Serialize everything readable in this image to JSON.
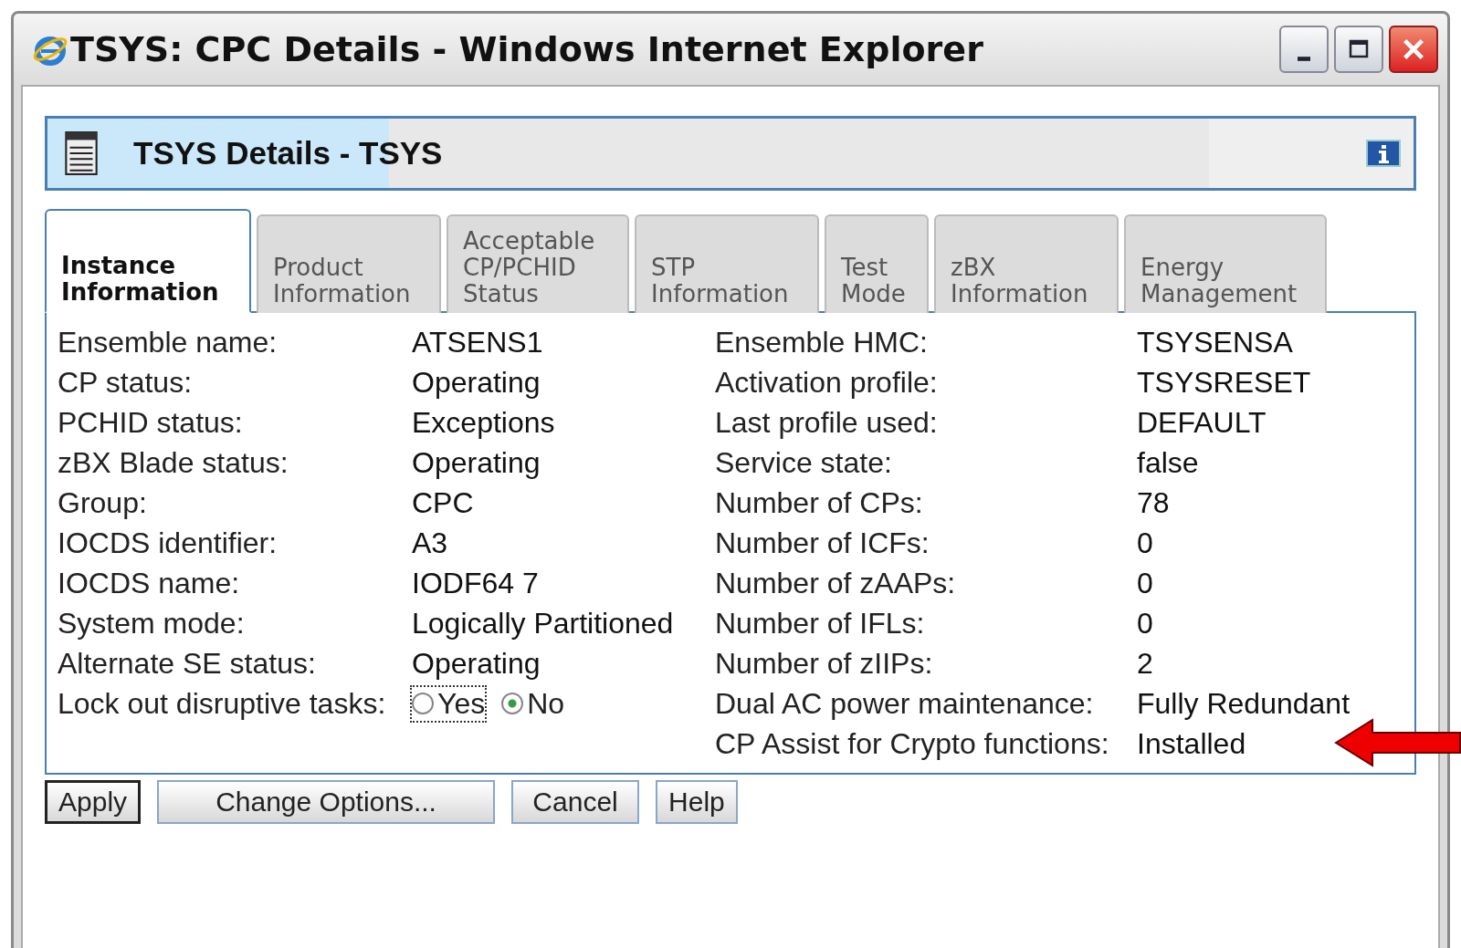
{
  "window": {
    "title": "TSYS: CPC Details - Windows Internet Explorer"
  },
  "header": {
    "title": "TSYS Details - TSYS"
  },
  "tabs": [
    {
      "label": "Instance Information",
      "selected": true
    },
    {
      "label": "Product Information",
      "selected": false
    },
    {
      "label": "Acceptable CP/PCHID Status",
      "selected": false
    },
    {
      "label": "STP Information",
      "selected": false
    },
    {
      "label": "Test Mode",
      "selected": false
    },
    {
      "label": "zBX Information",
      "selected": false
    },
    {
      "label": "Energy Management",
      "selected": false
    }
  ],
  "left_fields": [
    {
      "kind": "text",
      "label": "Ensemble name:",
      "value": "ATSENS1"
    },
    {
      "kind": "text",
      "label": "CP status:",
      "value": "Operating"
    },
    {
      "kind": "text",
      "label": "PCHID status:",
      "value": "Exceptions"
    },
    {
      "kind": "text",
      "label": "zBX Blade status:",
      "value": "Operating"
    },
    {
      "kind": "text",
      "label": "Group:",
      "value": "CPC"
    },
    {
      "kind": "text",
      "label": "IOCDS identifier:",
      "value": "A3"
    },
    {
      "kind": "text",
      "label": "IOCDS name:",
      "value": "IODF64 7"
    },
    {
      "kind": "text",
      "label": "System mode:",
      "value": "Logically Partitioned"
    },
    {
      "kind": "text",
      "label": "Alternate SE status:",
      "value": "Operating"
    },
    {
      "kind": "radio",
      "label": "Lock out disruptive tasks:",
      "options": [
        {
          "label": "Yes",
          "selected": false
        },
        {
          "label": "No",
          "selected": true
        }
      ]
    }
  ],
  "right_fields": [
    {
      "label": "Ensemble HMC:",
      "value": "TSYSENSA"
    },
    {
      "label": "Activation profile:",
      "value": "TSYSRESET"
    },
    {
      "label": "Last profile used:",
      "value": "DEFAULT"
    },
    {
      "label": "Service state:",
      "value": "false"
    },
    {
      "label": "Number of CPs:",
      "value": "78"
    },
    {
      "label": "Number of ICFs:",
      "value": "0"
    },
    {
      "label": "Number of zAAPs:",
      "value": "0"
    },
    {
      "label": "Number of IFLs:",
      "value": "0"
    },
    {
      "label": "Number of zIIPs:",
      "value": "2"
    },
    {
      "label": "Dual AC power maintenance:",
      "value": "Fully Redundant"
    },
    {
      "label": "CP Assist for Crypto functions:",
      "value": "Installed"
    }
  ],
  "buttons": [
    {
      "label": "Apply",
      "selected": true
    },
    {
      "label": "Change Options...",
      "selected": false
    },
    {
      "label": "Cancel",
      "selected": false
    },
    {
      "label": "Help",
      "selected": false
    }
  ]
}
